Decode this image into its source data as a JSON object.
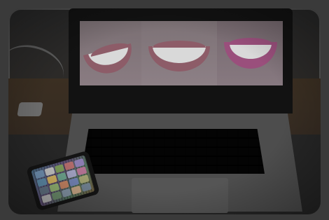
{
  "image": {
    "subject": "laptop-with-smile-photos-and-phone",
    "icon_names": [
      "laptop-icon",
      "phone-icon"
    ],
    "colors": {
      "frame": "#3a3a3a",
      "screen_photo": "#6d6468",
      "lips_natural": "#8d5c68",
      "lips_pink": "#9a4f7c",
      "teeth": "#d9d9d9"
    }
  },
  "phone_apps": [
    "#6f8fb0",
    "#c0c0c0",
    "#7b9a5a",
    "#b06a6a",
    "#8a7cb0",
    "#5d89a6",
    "#d0b060",
    "#6aa08a",
    "#a0a0c0",
    "#b07090",
    "#607080",
    "#90b070",
    "#c08060",
    "#7080b0",
    "#a0a070",
    "#b0b0b0",
    "#6a8a6a",
    "#8090a0",
    "#c0a080",
    "#708090"
  ]
}
